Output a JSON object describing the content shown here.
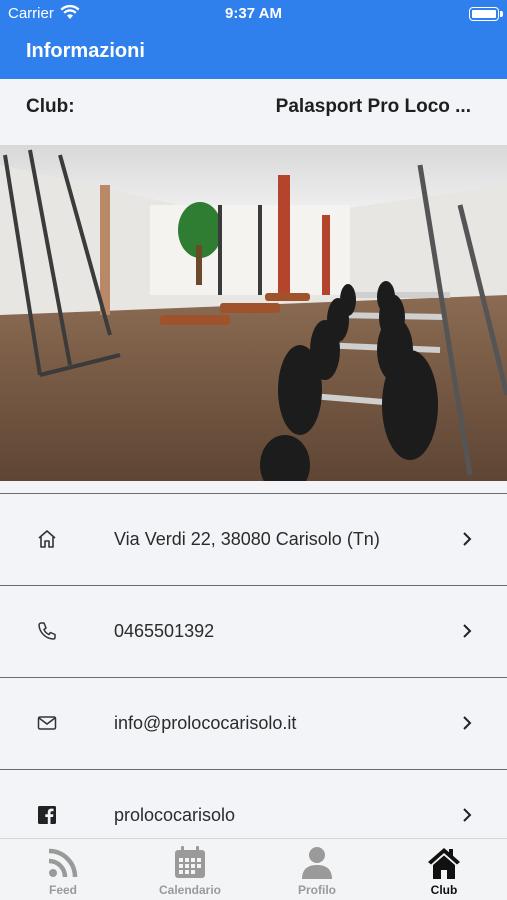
{
  "status_bar": {
    "carrier": "Carrier",
    "time": "9:37 AM"
  },
  "nav": {
    "title": "Informazioni"
  },
  "club": {
    "label": "Club:",
    "value": "Palasport Pro Loco ..."
  },
  "info_rows": [
    {
      "icon": "home-icon",
      "text": "Via Verdi 22, 38080 Carisolo (Tn)"
    },
    {
      "icon": "phone-icon",
      "text": "0465501392"
    },
    {
      "icon": "mail-icon",
      "text": "info@prolococarisolo.it"
    },
    {
      "icon": "facebook-icon",
      "text": "prolococarisolo"
    }
  ],
  "tabs": [
    {
      "label": "Feed",
      "icon": "rss-icon",
      "active": false
    },
    {
      "label": "Calendario",
      "icon": "calendar-icon",
      "active": false
    },
    {
      "label": "Profilo",
      "icon": "user-icon",
      "active": false
    },
    {
      "label": "Club",
      "icon": "home-filled-icon",
      "active": true
    }
  ],
  "colors": {
    "primary": "#2f80ed",
    "background": "#f2f4f8",
    "tab_inactive": "#9a9a9a",
    "tab_active": "#111111"
  }
}
